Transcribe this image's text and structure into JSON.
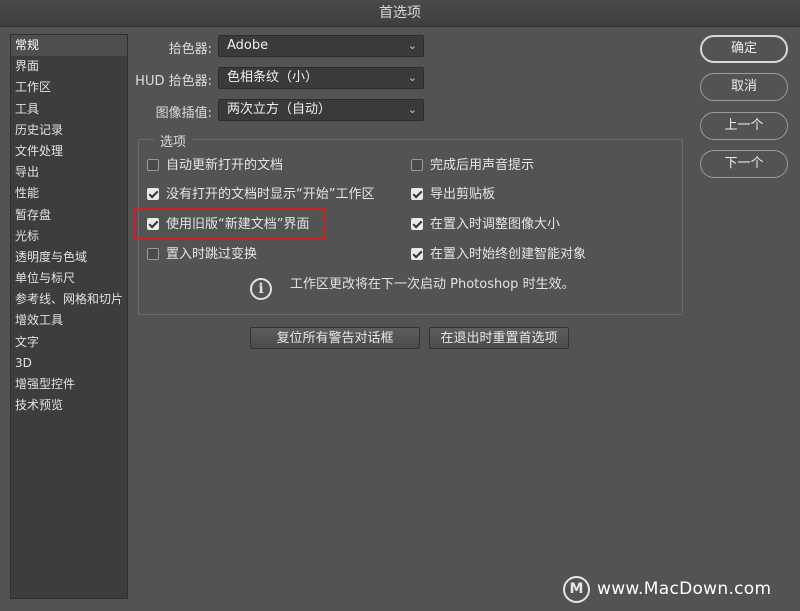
{
  "window": {
    "title": "首选项"
  },
  "sidebar": {
    "items": [
      {
        "label": "常规",
        "selected": true
      },
      {
        "label": "界面"
      },
      {
        "label": "工作区"
      },
      {
        "label": "工具"
      },
      {
        "label": "历史记录"
      },
      {
        "label": "文件处理"
      },
      {
        "label": "导出"
      },
      {
        "label": "性能"
      },
      {
        "label": "暂存盘"
      },
      {
        "label": "光标"
      },
      {
        "label": "透明度与色域"
      },
      {
        "label": "单位与标尺"
      },
      {
        "label": "参考线、网格和切片"
      },
      {
        "label": "增效工具"
      },
      {
        "label": "文字"
      },
      {
        "label": "3D"
      },
      {
        "label": "增强型控件"
      },
      {
        "label": "技术预览"
      }
    ]
  },
  "fields": {
    "color_picker": {
      "label": "拾色器:",
      "value": "Adobe"
    },
    "hud_color_picker": {
      "label": "HUD 拾色器:",
      "value": "色相条纹（小）"
    },
    "interpolation": {
      "label": "图像插值:",
      "value": "两次立方（自动）"
    }
  },
  "options": {
    "title": "选项",
    "left": [
      {
        "label": "自动更新打开的文档",
        "checked": false
      },
      {
        "label": "没有打开的文档时显示“开始”工作区",
        "checked": true
      },
      {
        "label": "使用旧版“新建文档”界面",
        "checked": true
      },
      {
        "label": "置入时跳过变换",
        "checked": false
      }
    ],
    "right": [
      {
        "label": "完成后用声音提示",
        "checked": false
      },
      {
        "label": "导出剪贴板",
        "checked": true
      },
      {
        "label": "在置入时调整图像大小",
        "checked": true
      },
      {
        "label": "在置入时始终创建智能对象",
        "checked": true
      }
    ],
    "info_text": "工作区更改将在下一次启动 Photoshop 时生效。"
  },
  "bottom_buttons": {
    "reset_warnings": "复位所有警告对话框",
    "reset_prefs": "在退出时重置首选项"
  },
  "right_buttons": {
    "ok": "确定",
    "cancel": "取消",
    "prev": "上一个",
    "next": "下一个"
  },
  "watermark": {
    "logo": "M",
    "text": "www.MacDown.com"
  },
  "colors": {
    "highlight": "#d01f24",
    "background": "#535353",
    "sidebar": "#3d3d3d"
  },
  "icons": {
    "dropdown": "chevron-down-icon",
    "info": "info-icon",
    "check": "check-icon"
  }
}
